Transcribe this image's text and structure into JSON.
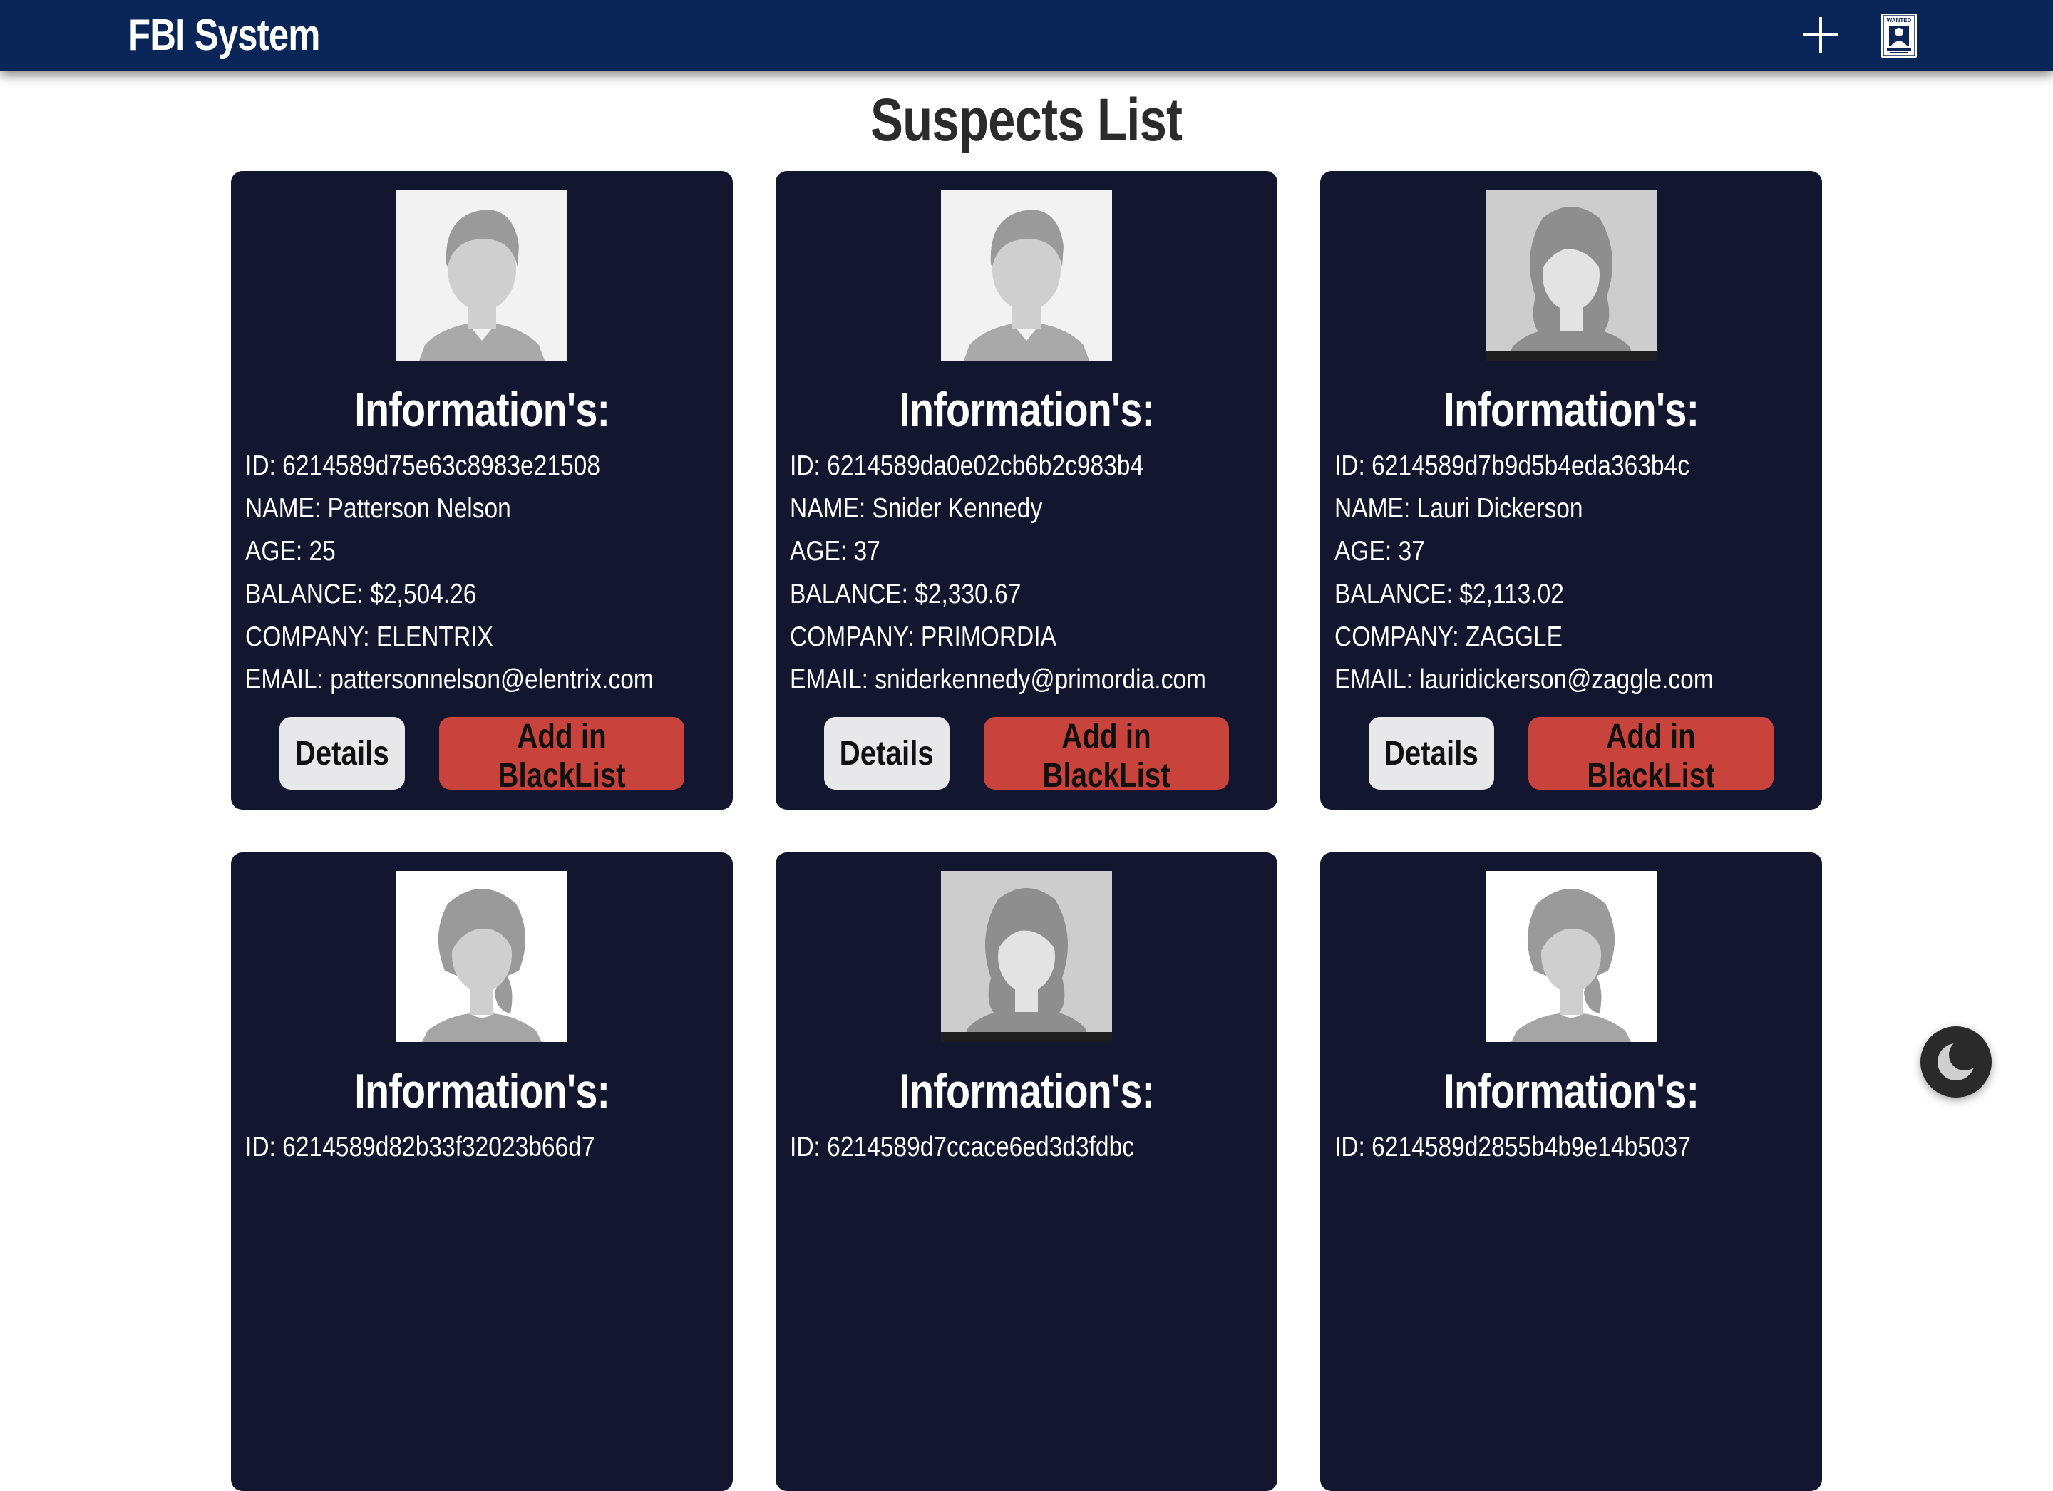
{
  "navbar": {
    "brand": "FBI System",
    "add_icon": "plus-icon",
    "wanted_icon": "wanted-poster-icon",
    "wanted_icon_text": "WANTED"
  },
  "page": {
    "title": "Suspects List"
  },
  "labels": {
    "info_title": "Information's:",
    "details_button": "Details",
    "blacklist_button": "Add in BlackList"
  },
  "suspects": [
    {
      "id": "ID: 6214589d75e63c8983e21508",
      "name": "NAME: Patterson Nelson",
      "age": "AGE: 25",
      "balance": "BALANCE: $2,504.26",
      "company": "COMPANY: ELENTRIX",
      "email": "EMAIL: pattersonnelson@elentrix.com",
      "avatar": "male-avatar"
    },
    {
      "id": "ID: 6214589da0e02cb6b2c983b4",
      "name": "NAME: Snider Kennedy",
      "age": "AGE: 37",
      "balance": "BALANCE: $2,330.67",
      "company": "COMPANY: PRIMORDIA",
      "email": "EMAIL: sniderkennedy@primordia.com",
      "avatar": "male-avatar"
    },
    {
      "id": "ID: 6214589d7b9d5b4eda363b4c",
      "name": "NAME: Lauri Dickerson",
      "age": "AGE: 37",
      "balance": "BALANCE: $2,113.02",
      "company": "COMPANY: ZAGGLE",
      "email": "EMAIL: lauridickerson@zaggle.com",
      "avatar": "female-avatar-stock"
    },
    {
      "id": "ID: 6214589d82b33f32023b66d7",
      "avatar": "female-avatar-ponytail"
    },
    {
      "id": "ID: 6214589d7ccace6ed3d3fdbc",
      "avatar": "female-avatar-stock"
    },
    {
      "id": "ID: 6214589d2855b4b9e14b5037",
      "avatar": "female-avatar-ponytail"
    }
  ],
  "theme_toggle": {
    "icon": "moon-icon"
  },
  "colors": {
    "navbar": "#0a2557",
    "card": "#12162f",
    "details_button": "#e8e8ea",
    "blacklist_button": "#c8433b",
    "theme_toggle": "#2a2a2a"
  }
}
